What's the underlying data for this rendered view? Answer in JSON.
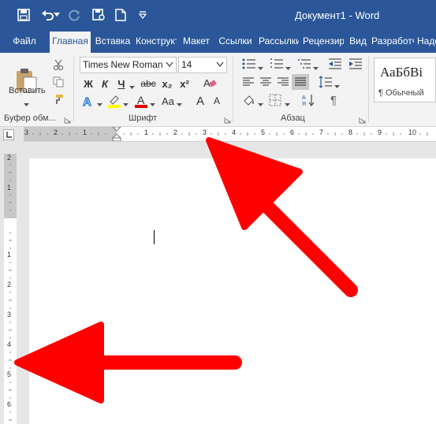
{
  "window": {
    "title": "Документ1 - Word"
  },
  "qat": {
    "save": "save-icon",
    "undo": "undo-icon",
    "redo": "redo-icon",
    "print": "print-preview-icon",
    "new": "new-doc-icon",
    "customize": "customize-qat-icon"
  },
  "tabs": [
    "Файл",
    "Главная",
    "Вставка",
    "Конструктор",
    "Макет",
    "Ссылки",
    "Рассылки",
    "Рецензирование",
    "Вид",
    "Разработчик",
    "Надстройки"
  ],
  "active_tab": "Главная",
  "ribbon": {
    "clipboard": {
      "label": "Буфер обм...",
      "paste_label": "Вставить"
    },
    "font": {
      "label": "Шрифт",
      "name": "Times New Roman",
      "size": "14",
      "bold": "Ж",
      "italic": "К",
      "underline": "Ч",
      "strike": "abc",
      "subscript": "x₂",
      "superscript": "x²",
      "case": "Aa",
      "grow": "A",
      "shrink": "A"
    },
    "paragraph": {
      "label": "Абзац"
    },
    "styles": {
      "sample": "АаБбВі",
      "name": "¶ Обычный"
    }
  },
  "ruler": {
    "h_numbers": [
      "3",
      "2",
      "1",
      "1",
      "2",
      "3",
      "4",
      "5",
      "6",
      "7",
      "8",
      "9",
      "10"
    ],
    "v_numbers": [
      "2",
      "1",
      "1",
      "2",
      "3",
      "4",
      "5",
      "6"
    ]
  },
  "colors": {
    "accent": "#2b579a",
    "ribbon": "#f3f3f3",
    "annotation": "#ff0000"
  },
  "annotations": [
    {
      "name": "arrow-to-horizontal-ruler"
    },
    {
      "name": "arrow-to-vertical-ruler"
    }
  ]
}
